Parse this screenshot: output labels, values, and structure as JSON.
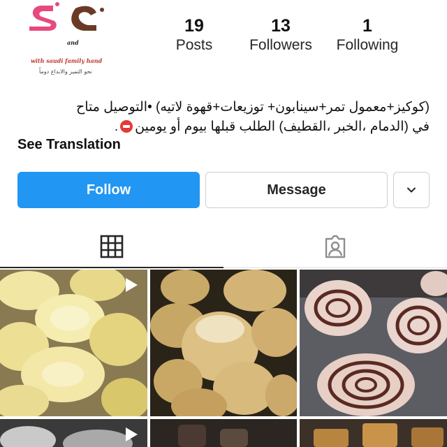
{
  "profile": {
    "logo_and": "and",
    "logo_tagline": "with saudi family hand",
    "logo_motto": "نحو التميز والابداع دوماً"
  },
  "stats": [
    {
      "value": "19",
      "label": "Posts"
    },
    {
      "value": "13",
      "label": "Followers"
    },
    {
      "value": "1",
      "label": "Following"
    }
  ],
  "bio": {
    "line1": "(كوكيز+معمول تمر+سينابون+ توزيعات+قهوة لاتيه) •التوصيل متاح",
    "line2_a": "في (الدمام ،الخبر ،القطيف) الطلب قبلها بيوم أو يومين",
    "line2_b": ".",
    "see_translation": "See Translation"
  },
  "actions": {
    "follow": "Follow",
    "message": "Message"
  },
  "tabs": [
    {
      "name": "grid",
      "icon": "grid-icon",
      "active": true
    },
    {
      "name": "tagged",
      "icon": "tagged-person-icon",
      "active": false
    }
  ],
  "posts": [
    {
      "type": "video",
      "subject": "cookies"
    },
    {
      "type": "photo",
      "subject": "maamoul"
    },
    {
      "type": "photo",
      "subject": "cinnamon rolls"
    },
    {
      "type": "video",
      "subject": "jars"
    },
    {
      "type": "photo",
      "subject": "bottles"
    },
    {
      "type": "photo",
      "subject": "gold lid jars"
    }
  ],
  "colors": {
    "follow_bg": "#2196f3",
    "logo_pink": "#e8487f",
    "logo_brown": "#6b3a25"
  }
}
